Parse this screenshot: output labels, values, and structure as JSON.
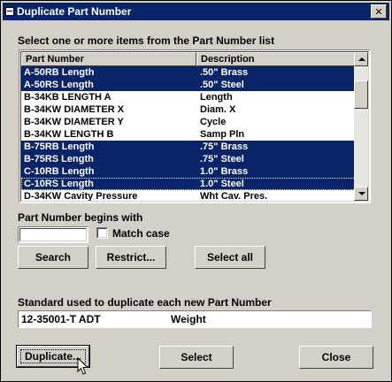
{
  "window": {
    "title": "Duplicate Part Number",
    "close_symbol": "✕"
  },
  "prompt": "Select one or more items from the Part Number list",
  "list": {
    "columns": [
      "Part Number",
      "Description"
    ],
    "rows": [
      {
        "part": "A-50RB Length",
        "desc": ".50\" Brass",
        "selected": true
      },
      {
        "part": "A-50RS Length",
        "desc": ".50\" Steel",
        "selected": true
      },
      {
        "part": "B-34KB LENGTH A",
        "desc": "Length",
        "selected": false
      },
      {
        "part": "B-34KW DIAMETER X",
        "desc": "Diam. X",
        "selected": false
      },
      {
        "part": "B-34KW DIAMETER Y",
        "desc": "Cycle",
        "selected": false
      },
      {
        "part": "B-34KW LENGTH B",
        "desc": "Samp Pln",
        "selected": false
      },
      {
        "part": "B-75RB Length",
        "desc": ".75\" Brass",
        "selected": true
      },
      {
        "part": "B-75RS Length",
        "desc": ".75\" Steel",
        "selected": true
      },
      {
        "part": "C-10RB Length",
        "desc": "1.0\" Brass",
        "selected": true
      },
      {
        "part": "C-10RS Length",
        "desc": "1.0\" Steel",
        "selected": true
      },
      {
        "part": "D-34KW Cavity Pressure",
        "desc": "Wht Cav. Pres.",
        "selected": false
      }
    ]
  },
  "filter": {
    "label": "Part Number begins with",
    "value": "",
    "match_case_label": "Match case",
    "match_case_checked": false
  },
  "buttons": {
    "search": "Search",
    "restrict": "Restrict...",
    "select_all": "Select all",
    "duplicate": "Duplicate...",
    "select": "Select",
    "close": "Close"
  },
  "standard": {
    "label": "Standard used to duplicate each new Part Number",
    "part": "12-35001-T ADT",
    "desc": "Weight"
  },
  "colors": {
    "titlebar": "#0a246a",
    "selection": "#0a246a",
    "face": "#d4d0c8"
  }
}
